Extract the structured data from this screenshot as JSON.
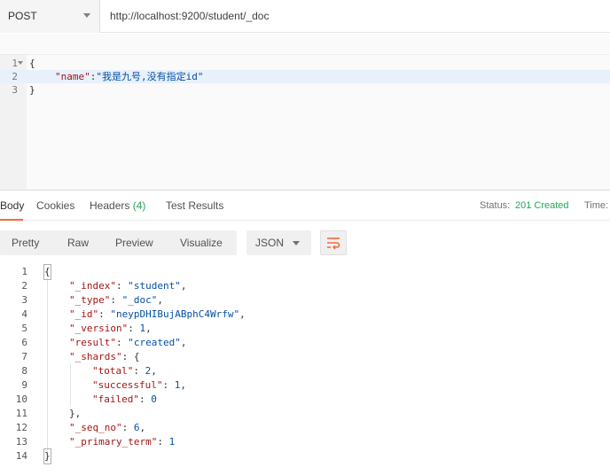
{
  "request": {
    "method": "POST",
    "url": "http://localhost:9200/student/_doc",
    "body_lines": [
      {
        "num": "1",
        "open": "{"
      },
      {
        "num": "2",
        "key": "\"name\"",
        "colon": ":",
        "value": "\"我是九号,没有指定id\""
      },
      {
        "num": "3",
        "close": "}"
      }
    ]
  },
  "response_tabs": {
    "body": "Body",
    "cookies": "Cookies",
    "headers_label": "Headers",
    "headers_count": "(4)",
    "test_results": "Test Results"
  },
  "status": {
    "label": "Status:",
    "value": "201 Created",
    "time_label": "Time:"
  },
  "view_modes": [
    "Pretty",
    "Raw",
    "Preview",
    "Visualize"
  ],
  "format": {
    "selected": "JSON"
  },
  "response_lines": [
    {
      "num": "1",
      "text": "{"
    },
    {
      "num": "2",
      "key": "\"_index\"",
      "value": "\"student\"",
      "tail": ","
    },
    {
      "num": "3",
      "key": "\"_type\"",
      "value": "\"_doc\"",
      "tail": ","
    },
    {
      "num": "4",
      "key": "\"_id\"",
      "value": "\"neypDHIBujABphC4Wrfw\"",
      "tail": ","
    },
    {
      "num": "5",
      "key": "\"_version\"",
      "value": "1",
      "tail": ","
    },
    {
      "num": "6",
      "key": "\"result\"",
      "value": "\"created\"",
      "tail": ","
    },
    {
      "num": "7",
      "key": "\"_shards\"",
      "value": "{",
      "tail": ""
    },
    {
      "num": "8",
      "key": "\"total\"",
      "value": "2",
      "tail": ","
    },
    {
      "num": "9",
      "key": "\"successful\"",
      "value": "1",
      "tail": ","
    },
    {
      "num": "10",
      "key": "\"failed\"",
      "value": "0",
      "tail": ""
    },
    {
      "num": "11",
      "text": "},"
    },
    {
      "num": "12",
      "key": "\"_seq_no\"",
      "value": "6",
      "tail": ","
    },
    {
      "num": "13",
      "key": "\"_primary_term\"",
      "value": "1",
      "tail": ""
    },
    {
      "num": "14",
      "text": "}"
    }
  ],
  "colors": {
    "accent": "#f26b3a",
    "status_green": "#26a65b",
    "json_key": "#a31515",
    "json_value": "#0451a5"
  }
}
